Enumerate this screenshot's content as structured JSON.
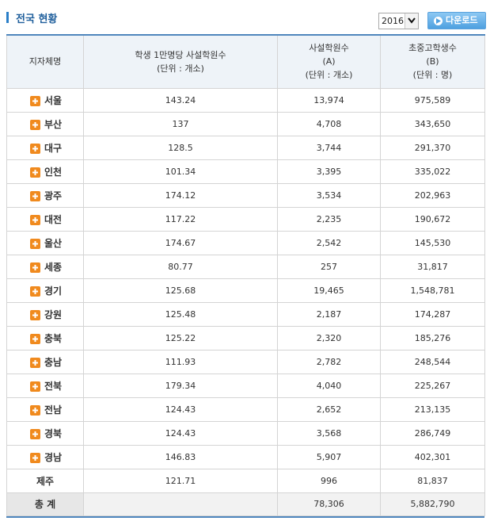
{
  "header": {
    "title": "전국 현황"
  },
  "year_select": {
    "value": "2016"
  },
  "download": {
    "label": "다운로드"
  },
  "table": {
    "headers": [
      {
        "line1": "지자체명",
        "line2": "",
        "line3": ""
      },
      {
        "line1": "학생 1만명당 사설학원수",
        "line2": "(단위 : 개소)",
        "line3": ""
      },
      {
        "line1": "사설학원수",
        "line2": "(A)",
        "line3": "(단위 : 개소)"
      },
      {
        "line1": "초중고학생수",
        "line2": "(B)",
        "line3": "(단위 : 명)"
      }
    ],
    "rows": [
      {
        "region": "서울",
        "expandable": true,
        "per10k": "143.24",
        "academies": "13,974",
        "students": "975,589"
      },
      {
        "region": "부산",
        "expandable": true,
        "per10k": "137",
        "academies": "4,708",
        "students": "343,650"
      },
      {
        "region": "대구",
        "expandable": true,
        "per10k": "128.5",
        "academies": "3,744",
        "students": "291,370"
      },
      {
        "region": "인천",
        "expandable": true,
        "per10k": "101.34",
        "academies": "3,395",
        "students": "335,022"
      },
      {
        "region": "광주",
        "expandable": true,
        "per10k": "174.12",
        "academies": "3,534",
        "students": "202,963"
      },
      {
        "region": "대전",
        "expandable": true,
        "per10k": "117.22",
        "academies": "2,235",
        "students": "190,672"
      },
      {
        "region": "울산",
        "expandable": true,
        "per10k": "174.67",
        "academies": "2,542",
        "students": "145,530"
      },
      {
        "region": "세종",
        "expandable": true,
        "per10k": "80.77",
        "academies": "257",
        "students": "31,817"
      },
      {
        "region": "경기",
        "expandable": true,
        "per10k": "125.68",
        "academies": "19,465",
        "students": "1,548,781"
      },
      {
        "region": "강원",
        "expandable": true,
        "per10k": "125.48",
        "academies": "2,187",
        "students": "174,287"
      },
      {
        "region": "충북",
        "expandable": true,
        "per10k": "125.22",
        "academies": "2,320",
        "students": "185,276"
      },
      {
        "region": "충남",
        "expandable": true,
        "per10k": "111.93",
        "academies": "2,782",
        "students": "248,544"
      },
      {
        "region": "전북",
        "expandable": true,
        "per10k": "179.34",
        "academies": "4,040",
        "students": "225,267"
      },
      {
        "region": "전남",
        "expandable": true,
        "per10k": "124.43",
        "academies": "2,652",
        "students": "213,135"
      },
      {
        "region": "경북",
        "expandable": true,
        "per10k": "124.43",
        "academies": "3,568",
        "students": "286,749"
      },
      {
        "region": "경남",
        "expandable": true,
        "per10k": "146.83",
        "academies": "5,907",
        "students": "402,301"
      },
      {
        "region": "제주",
        "expandable": false,
        "per10k": "121.71",
        "academies": "996",
        "students": "81,837"
      }
    ],
    "total": {
      "region": "총 계",
      "per10k": "",
      "academies": "78,306",
      "students": "5,882,790"
    }
  },
  "colors": {
    "accent": "#4f86bd",
    "title": "#1f5f9c",
    "plus": "#f08a1e",
    "header_bg": "#eef3f8"
  }
}
